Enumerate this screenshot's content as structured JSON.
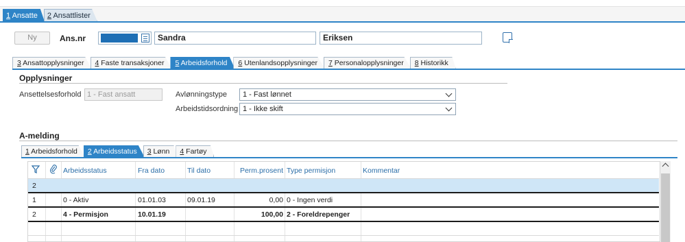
{
  "top_tabs": [
    {
      "num": "1",
      "label": " Ansatte",
      "active": true
    },
    {
      "num": "2",
      "label": " Ansattlister",
      "active": false
    }
  ],
  "header": {
    "new_button": "Ny",
    "ansnr_label": "Ans.nr",
    "first_name": "Sandra",
    "last_name": "Eriksen"
  },
  "main_tabs": [
    {
      "num": "3",
      "label": " Ansattopplysninger"
    },
    {
      "num": "4",
      "label": " Faste transaksjoner"
    },
    {
      "num": "5",
      "label": " Arbeidsforhold"
    },
    {
      "num": "6",
      "label": " Utenlandsopplysninger"
    },
    {
      "num": "7",
      "label": " Personalopplysninger"
    },
    {
      "num": "8",
      "label": " Historikk"
    }
  ],
  "opplysninger": {
    "title": "Opplysninger",
    "ansettelsesforhold_label": "Ansettelsesforhold",
    "ansettelsesforhold_value": "1 - Fast ansatt",
    "avlonningstype_label": "Avlønningstype",
    "avlonningstype_value": "1 - Fast lønnet",
    "arbeidstid_label": "Arbeidstidsordning",
    "arbeidstid_value": "1 - Ikke skift"
  },
  "amelding": {
    "title": "A-melding",
    "tabs": [
      {
        "num": "1",
        "label": " Arbeidsforhold"
      },
      {
        "num": "2",
        "label": " Arbeidsstatus"
      },
      {
        "num": "3",
        "label": " Lønn"
      },
      {
        "num": "4",
        "label": " Fartøy"
      }
    ]
  },
  "grid": {
    "columns": [
      "Arbeidsstatus",
      "Fra dato",
      "Til dato",
      "Perm.prosent",
      "Type permisjon",
      "Kommentar"
    ],
    "rows": [
      {
        "idx": "2",
        "status": "",
        "fra": "",
        "til": "",
        "perm": "",
        "type": "",
        "kommentar": ""
      },
      {
        "idx": "1",
        "status": "0 - Aktiv",
        "fra": "01.01.03",
        "til": "09.01.19",
        "perm": "0,00",
        "type": "0 - Ingen verdi",
        "kommentar": ""
      },
      {
        "idx": "2",
        "status": "4 - Permisjon",
        "fra": "10.01.19",
        "til": "",
        "perm": "100,00",
        "type": "2 - Foreldrepenger",
        "kommentar": ""
      }
    ]
  },
  "colors": {
    "accent": "#2e84c7",
    "selected_row": "#cfe6f7",
    "header_text": "#2b6ea8"
  }
}
